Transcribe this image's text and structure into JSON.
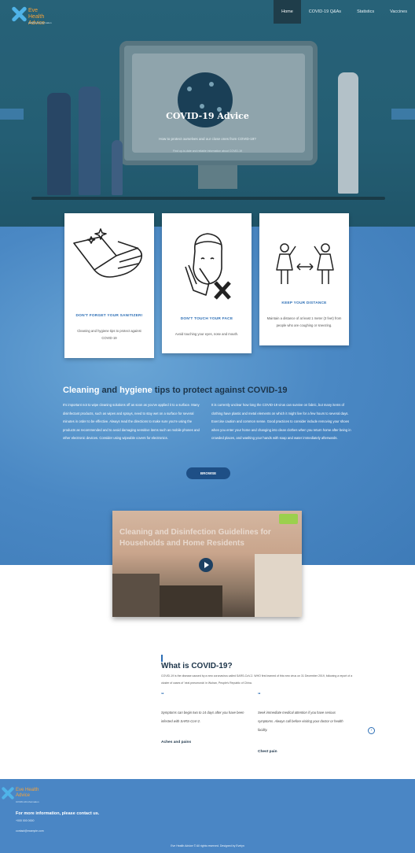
{
  "brand": {
    "name": "Eve Health Advice",
    "tagline": "COVID-19 information"
  },
  "nav": {
    "items": [
      "Home",
      "COVID-19 Q&As",
      "Statistics",
      "Vaccines"
    ],
    "active": "Home"
  },
  "hero": {
    "title": "COVID-19 Advice",
    "subtitle": "How to protect ourselves and our close ones from COVID-19?",
    "subtitle2": "Find up-to-date and reliable information about COVID-19"
  },
  "cards": [
    {
      "title": "DON'T FORGET YOUR SANITIZER!",
      "text": "Cleaning and hygiene tips to protect against COVID-19",
      "icon": "sanitizer-hand-icon"
    },
    {
      "title": "DON'T TOUCH YOUR FACE",
      "text": "Avoid touching your eyes, nose and mouth.",
      "icon": "no-face-touch-icon"
    },
    {
      "title": "KEEP YOUR DISTANCE",
      "text": "Maintain a distance of at least 1 meter (3 feet) from people who are coughing or sneezing.",
      "icon": "social-distance-icon"
    }
  ],
  "cleaning": {
    "title_parts": [
      "Cleaning",
      " and ",
      "hygiene",
      " tips to protect against COVID-19"
    ],
    "left": "It's important not to wipe cleaning solutions off as soon as you've applied it to a surface. Many disinfectant products, such as wipes and sprays, need to stay wet on a surface for several minutes in order to be effective. Always read the directions to make sure you're using the products as recommended and to avoid damaging sensitive items such as mobile phones and other electronic devices. Consider using wipeable covers for electronics.",
    "right": "It is currently unclear how long the COVID-19 virus can survive on fabric, but many items of clothing have plastic and metal elements on which it might live for a few hours to several days. Exercise caution and common sense. Good practices to consider include removing your shoes when you enter your home and changing into clean clothes when you return home after being in crowded places, and washing your hands with soap and water immediately afterwards.",
    "browse_label": "BROWSE"
  },
  "video": {
    "title": "Cleaning and Disinfection Guidelines for Households and Home Residents"
  },
  "what": {
    "title": "What is COVID-19?",
    "text": "COVID-19 is the disease caused by a new coronavirus called SARS-CoV-2. WHO first learned of this new virus on 31 December 2019, following a report of a cluster of cases of 'viral pneumonia' in Wuhan, People's Republic of China.",
    "quotes": [
      {
        "mark": "“",
        "text": "Symptoms can begin two to 14 days after you have been infected with SARS-CoV-2.",
        "label": "Aches and pains"
      },
      {
        "mark": "“",
        "text": "Seek immediate medical attention if you have serious symptoms. Always call before visiting your doctor or health facility.",
        "label": "Chest pain"
      }
    ],
    "arrow": "›"
  },
  "footer": {
    "brand": "Eve Health Advice",
    "tagline": "COVID-19 information",
    "info": "For more information, please contact us.",
    "phone": "+000 000 0000",
    "email": "contact@example.com",
    "copyright": "Eve Health Advice © All rights reserved. Designed by Evelyn"
  },
  "colors": {
    "accent": "#2c6eb5",
    "navy": "#1c3449",
    "brand_orange": "#f5a23a",
    "footer": "#4a86c5"
  }
}
